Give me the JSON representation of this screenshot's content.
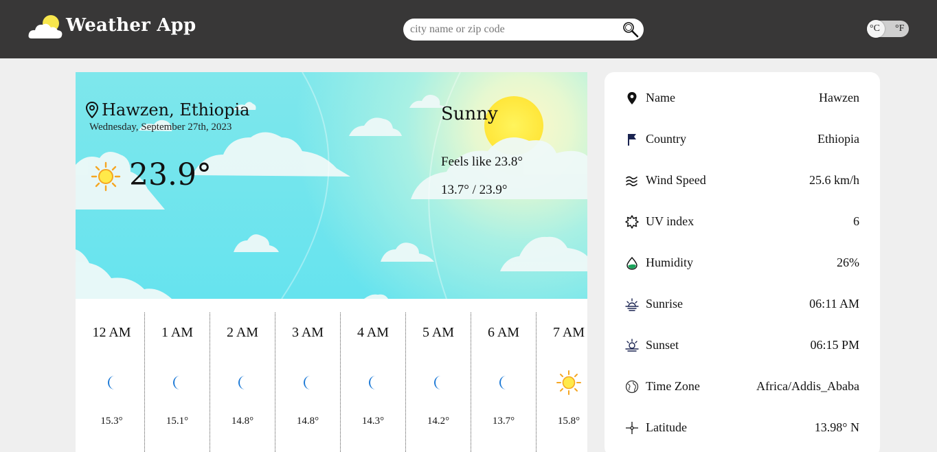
{
  "header": {
    "app_title": "Weather App",
    "search_placeholder": "city name or zip code",
    "unit_celsius": "°C",
    "unit_fahrenheit": "°F",
    "selected_unit": "°C"
  },
  "current": {
    "location": "Hawzen, Ethiopia",
    "date": "Wednesday, September 27th, 2023",
    "temperature": "23.9°",
    "condition": "Sunny",
    "feels_like": "Feels like 23.8°",
    "range": "13.7° / 23.9°",
    "icon": "sun-icon"
  },
  "hourly": [
    {
      "time": "12 AM",
      "icon": "moon-icon",
      "temp": "15.3°"
    },
    {
      "time": "1 AM",
      "icon": "moon-icon",
      "temp": "15.1°"
    },
    {
      "time": "2 AM",
      "icon": "moon-icon",
      "temp": "14.8°"
    },
    {
      "time": "3 AM",
      "icon": "moon-icon",
      "temp": "14.8°"
    },
    {
      "time": "4 AM",
      "icon": "moon-icon",
      "temp": "14.3°"
    },
    {
      "time": "5 AM",
      "icon": "moon-icon",
      "temp": "14.2°"
    },
    {
      "time": "6 AM",
      "icon": "moon-icon",
      "temp": "13.7°"
    },
    {
      "time": "7 AM",
      "icon": "sun-icon",
      "temp": "15.8°"
    }
  ],
  "details": [
    {
      "icon": "pin-icon",
      "label": "Name",
      "value": "Hawzen"
    },
    {
      "icon": "flag-icon",
      "label": "Country",
      "value": "Ethiopia"
    },
    {
      "icon": "wind-icon",
      "label": "Wind Speed",
      "value": "25.6 km/h"
    },
    {
      "icon": "uv-icon",
      "label": "UV index",
      "value": "6"
    },
    {
      "icon": "humidity-icon",
      "label": "Humidity",
      "value": "26%"
    },
    {
      "icon": "sunrise-icon",
      "label": "Sunrise",
      "value": "06:11 AM"
    },
    {
      "icon": "sunset-icon",
      "label": "Sunset",
      "value": "06:15 PM"
    },
    {
      "icon": "globe-icon",
      "label": "Time Zone",
      "value": "Africa/Addis_Ababa"
    },
    {
      "icon": "latitude-icon",
      "label": "Latitude",
      "value": "13.98° N"
    }
  ],
  "colors": {
    "header_bg": "#383737",
    "page_bg": "#efefef",
    "sky": "#66e3ee",
    "sun": "#ffe94a",
    "moon": "#1e7ad6",
    "flag": "#1a2350",
    "humidity": "#1aa35a"
  }
}
